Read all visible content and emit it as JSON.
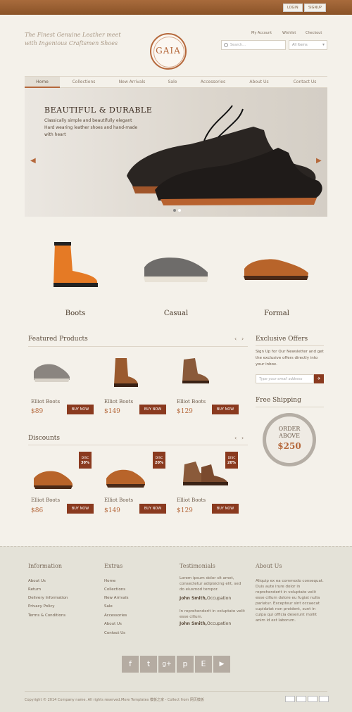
{
  "auth": {
    "login": "LOGIN",
    "signup": "SIGNUP"
  },
  "header": {
    "tagline": "The Finest Genuine Leather meet with Ingenious Craftsmen Shoes",
    "logo": "GAIA",
    "links": [
      "My Account",
      "Wishlist",
      "Checkout"
    ],
    "search_placeholder": "Search...",
    "filter_value": "All Items"
  },
  "nav": [
    "Home",
    "Collections",
    "New Arrivals",
    "Sale",
    "Accessories",
    "About Us",
    "Contact Us"
  ],
  "hero": {
    "title": "BEAUTIFUL & DURABLE",
    "desc": "Classically simple and beautifully elegant Hard wearing leather shoes and hand-made with heart"
  },
  "categories": [
    "Boots",
    "Casual",
    "Formal"
  ],
  "featured": {
    "title": "Featured Products",
    "items": [
      {
        "name": "Elliot Boots",
        "price": "$89",
        "buy": "BUY NOW"
      },
      {
        "name": "Elliot Boots",
        "price": "$149",
        "buy": "BUY NOW"
      },
      {
        "name": "Elliot Boots",
        "price": "$129",
        "buy": "BUY NOW"
      }
    ]
  },
  "discounts": {
    "title": "Discounts",
    "items": [
      {
        "name": "Elliot Boots",
        "price": "$86",
        "buy": "BUY NOW",
        "tag_top": "DISC",
        "tag_val": "30%"
      },
      {
        "name": "Elliot Boots",
        "price": "$149",
        "buy": "BUY NOW",
        "tag_top": "DISC",
        "tag_val": "20%"
      },
      {
        "name": "Elliot Boots",
        "price": "$129",
        "buy": "BUY NOW",
        "tag_top": "DISC",
        "tag_val": "20%"
      }
    ]
  },
  "offers": {
    "title": "Exclusive Offers",
    "text": "Sign Up for Our Newsletter and get the exclusive offers directly into your inbox.",
    "placeholder": "Type your email address"
  },
  "shipping": {
    "title": "Free Shipping",
    "line1": "ORDER",
    "line2": "ABOVE",
    "amount": "$250"
  },
  "footer": {
    "information": {
      "title": "Information",
      "links": [
        "About Us",
        "Return",
        "Delivery Information",
        "Privacy Policy",
        "Terms & Conditions"
      ]
    },
    "extras": {
      "title": "Extras",
      "links": [
        "Home",
        "Collections",
        "New Arrivals",
        "Sale",
        "Accessories",
        "About Us",
        "Contact Us"
      ]
    },
    "testimonials": {
      "title": "Testimonials",
      "quotes": [
        {
          "text": "Lorem ipsum dolor sit amet, consectetur adipisicing elit, sed do eiusmod tempor.",
          "author": "John Smith,",
          "role": "Occupation"
        },
        {
          "text": "In reprehenderit in voluptate velit esse cillum.",
          "author": "John Smith,",
          "role": "Occupation"
        }
      ]
    },
    "about": {
      "title": "About Us",
      "text": "Aliquip ex ea commodo consequat. Duis aute irure dolor in reprehenderit in voluptate velit esse cillum dolore eu fugiat nulla pariatur. Excepteur sint occaecat cupidatat non proident, sunt in culpa qui officia deserunt mollit anim id est laborum."
    },
    "social": [
      "f",
      "t",
      "g+",
      "p",
      "E",
      "▶"
    ],
    "copyright": "Copyright © 2014 Company name. All rights reserved.More Templates 模板之家 - Collect from 网页模板"
  },
  "colors": {
    "accent": "#b5683b",
    "button": "#8a3a1f",
    "topbar": "#a86b3c"
  }
}
